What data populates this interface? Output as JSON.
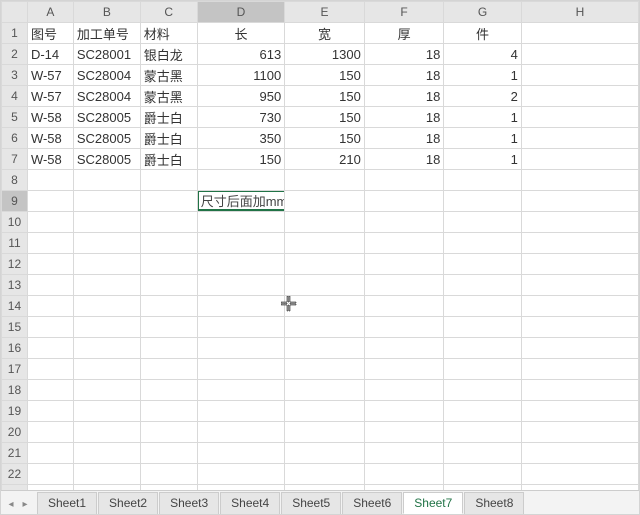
{
  "columns": [
    "A",
    "B",
    "C",
    "D",
    "E",
    "F",
    "G",
    "H"
  ],
  "rowCount": 23,
  "activeCol": "D",
  "activeRow": 9,
  "headers": {
    "A": "图号",
    "B": "加工单号",
    "C": "材料",
    "D": "长",
    "E": "宽",
    "F": "厚",
    "G": "件"
  },
  "rows": [
    {
      "A": "D-14",
      "B": "SC28001",
      "C": "银白龙",
      "D": 613,
      "E": 1300,
      "F": 18,
      "G": 4
    },
    {
      "A": "W-57",
      "B": "SC28004",
      "C": "蒙古黑",
      "D": 1100,
      "E": 150,
      "F": 18,
      "G": 1
    },
    {
      "A": "W-57",
      "B": "SC28004",
      "C": "蒙古黑",
      "D": 950,
      "E": 150,
      "F": 18,
      "G": 2
    },
    {
      "A": "W-58",
      "B": "SC28005",
      "C": "爵士白",
      "D": 730,
      "E": 150,
      "F": 18,
      "G": 1
    },
    {
      "A": "W-58",
      "B": "SC28005",
      "C": "爵士白",
      "D": 350,
      "E": 150,
      "F": 18,
      "G": 1
    },
    {
      "A": "W-58",
      "B": "SC28005",
      "C": "爵士白",
      "D": 150,
      "E": 210,
      "F": 18,
      "G": 1
    }
  ],
  "editCell": {
    "row": 9,
    "col": "D",
    "value": "尺寸后面加mm"
  },
  "sheets": [
    "Sheet1",
    "Sheet2",
    "Sheet3",
    "Sheet4",
    "Sheet5",
    "Sheet6",
    "Sheet7",
    "Sheet8"
  ],
  "activeSheet": "Sheet7"
}
